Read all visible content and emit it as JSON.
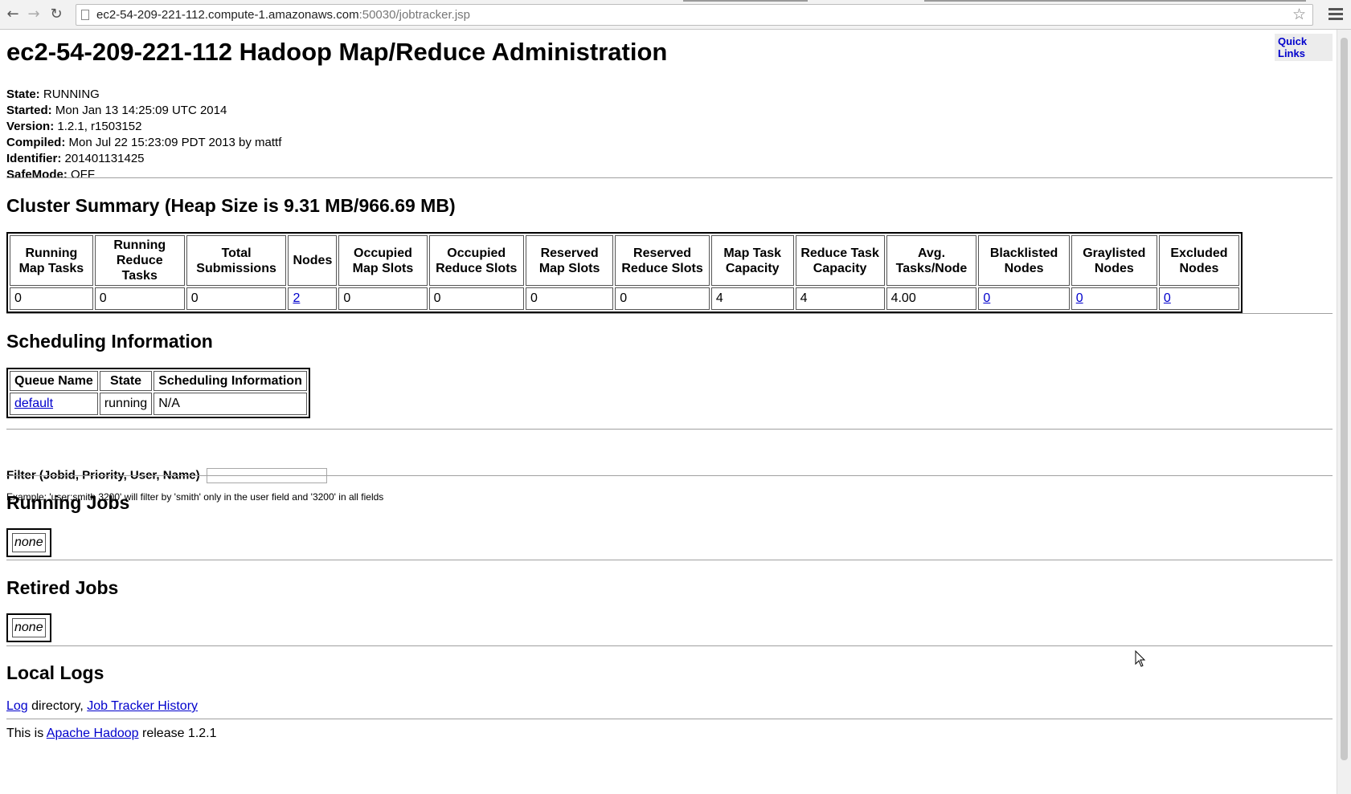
{
  "browser": {
    "back_glyph": "←",
    "forward_glyph": "→",
    "reload_glyph": "↻",
    "url_host": "ec2-54-209-221-112.compute-1.amazonaws.com",
    "url_rest": ":50030/jobtracker.jsp",
    "star_glyph": "☆",
    "icons": [
      "back-arrow-icon",
      "forward-arrow-icon",
      "reload-icon",
      "page-icon",
      "star-icon",
      "hamburger-menu-icon"
    ]
  },
  "page": {
    "quick_links": "Quick Links",
    "title": "ec2-54-209-221-112 Hadoop Map/Reduce Administration",
    "info": [
      {
        "label": "State:",
        "value": " RUNNING"
      },
      {
        "label": "Started:",
        "value": " Mon Jan 13 14:25:09 UTC 2014"
      },
      {
        "label": "Version:",
        "value": " 1.2.1, r1503152"
      },
      {
        "label": "Compiled:",
        "value": " Mon Jul 22 15:23:09 PDT 2013 by mattf"
      },
      {
        "label": "Identifier:",
        "value": " 201401131425"
      },
      {
        "label": "SafeMode:",
        "value": " OFF"
      }
    ],
    "cluster_summary": {
      "heading": "Cluster Summary (Heap Size is 9.31 MB/966.69 MB)",
      "headers": [
        "Running Map Tasks",
        "Running Reduce Tasks",
        "Total Submissions",
        "Nodes",
        "Occupied Map Slots",
        "Occupied Reduce Slots",
        "Reserved Map Slots",
        "Reserved Reduce Slots",
        "Map Task Capacity",
        "Reduce Task Capacity",
        "Avg. Tasks/Node",
        "Blacklisted Nodes",
        "Graylisted Nodes",
        "Excluded Nodes"
      ],
      "values": [
        "0",
        "0",
        "0",
        "2",
        "0",
        "0",
        "0",
        "0",
        "4",
        "4",
        "4.00",
        "0",
        "0",
        "0"
      ],
      "link_columns": [
        3,
        11,
        12,
        13
      ]
    },
    "scheduling": {
      "heading": "Scheduling Information",
      "headers": [
        "Queue Name",
        "State",
        "Scheduling Information"
      ],
      "row": [
        "default",
        "running",
        "N/A"
      ]
    },
    "filter": {
      "label": "Filter (Jobid, Priority, User, Name)",
      "value": "",
      "example": "Example: 'user:smith 3200' will filter by 'smith' only in the user field and '3200' in all fields"
    },
    "running_jobs": {
      "heading": "Running Jobs",
      "empty": "none"
    },
    "retired_jobs": {
      "heading": "Retired Jobs",
      "empty": "none"
    },
    "local_logs": {
      "heading": "Local Logs",
      "log_link": "Log",
      "directory_text": " directory, ",
      "history_link": "Job Tracker History"
    },
    "footer": {
      "prefix": "This is ",
      "link": "Apache Hadoop",
      "suffix": " release 1.2.1"
    }
  }
}
